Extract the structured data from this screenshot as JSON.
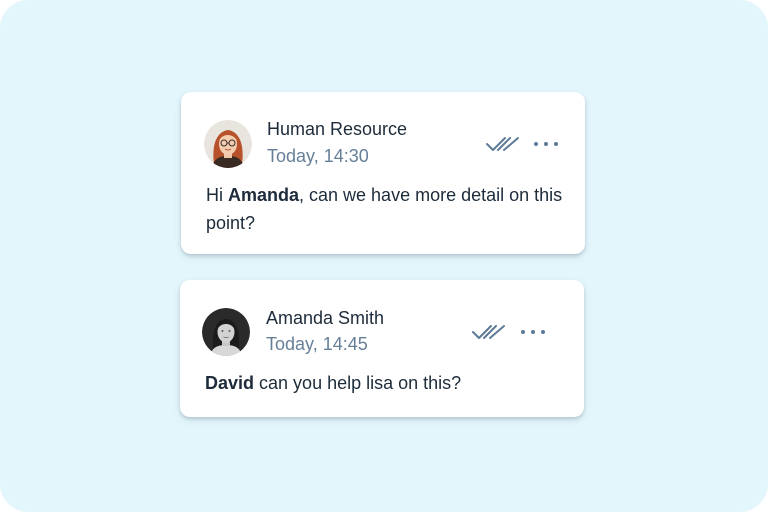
{
  "colors": {
    "background": "#e3f6fc",
    "card": "#ffffff",
    "text_primary": "#1d2b3a",
    "text_secondary": "#667f99",
    "icon": "#5d7a96"
  },
  "messages": [
    {
      "sender": "Human Resource",
      "time": "Today, 14:30",
      "avatar": "avatar-red-hair-glasses",
      "status_icon": "double-check-icon",
      "menu_icon": "more-horizontal-icon",
      "text_parts": {
        "before": "Hi ",
        "mention": "Amanda",
        "after": ", can we have more detail on this point?"
      }
    },
    {
      "sender": "Amanda Smith",
      "time": "Today, 14:45",
      "avatar": "avatar-dark-hair",
      "status_icon": "double-check-icon",
      "menu_icon": "more-horizontal-icon",
      "text_parts": {
        "before": "",
        "mention": "David",
        "after": " can you help lisa on this?"
      }
    }
  ]
}
